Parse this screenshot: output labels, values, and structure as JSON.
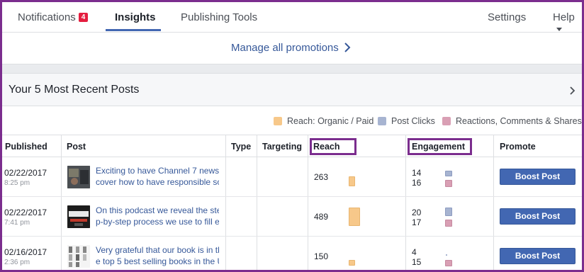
{
  "nav": {
    "tabs": [
      {
        "label": "Notifications",
        "badge": "4"
      },
      {
        "label": "Insights",
        "active": true
      },
      {
        "label": "Publishing Tools"
      }
    ],
    "settings_label": "Settings",
    "help_label": "Help"
  },
  "manage": {
    "label": "Manage all promotions"
  },
  "panel": {
    "title": "Your 5 Most Recent Posts",
    "legend": [
      {
        "label": "Reach: Organic / Paid",
        "color": "#f7c88a"
      },
      {
        "label": "Post Clicks",
        "color": "#a7b4d1"
      },
      {
        "label": "Reactions, Comments & Shares",
        "color": "#d99fb4"
      }
    ],
    "columns": {
      "published": "Published",
      "post": "Post",
      "type": "Type",
      "targeting": "Targeting",
      "reach": "Reach",
      "engagement": "Engagement",
      "promote": "Promote"
    },
    "rows": [
      {
        "date": "02/22/2017",
        "time": "8:25 pm",
        "text_line1": "Exciting to have Channel 7 news,",
        "text_line2": "cover how to have responsible so",
        "reach": "263",
        "clicks": "14",
        "reactions": "16",
        "reach_level": 0.54,
        "clicks_level": 0.7,
        "reactions_level": 0.8,
        "boost_label": "Boost Post",
        "thumb_icon": "video-thumbnail-icon"
      },
      {
        "date": "02/22/2017",
        "time": "7:41 pm",
        "text_line1": "On this podcast we reveal the ste",
        "text_line2": "p-by-step process we use to fill ev",
        "reach": "489",
        "clicks": "20",
        "reactions": "17",
        "reach_level": 1.0,
        "clicks_level": 1.0,
        "reactions_level": 0.85,
        "boost_label": "Boost Post",
        "thumb_icon": "podcast-thumbnail-icon"
      },
      {
        "date": "02/16/2017",
        "time": "2:36 pm",
        "text_line1": "Very grateful that our book is in th",
        "text_line2": "e top 5 best selling books in the U",
        "reach": "150",
        "clicks": "4",
        "reactions": "15",
        "reach_level": 0.31,
        "clicks_level": 0.2,
        "reactions_level": 0.75,
        "boost_label": "Boost Post",
        "thumb_icon": "book-thumbnail-icon"
      }
    ]
  }
}
